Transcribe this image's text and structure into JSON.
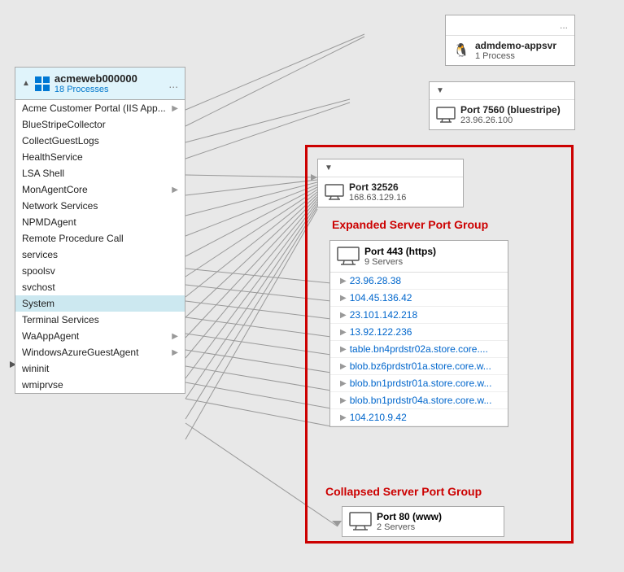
{
  "leftPanel": {
    "title": "acmeweb000000",
    "subtitle": "18 Processes",
    "menuLabel": "...",
    "processes": [
      {
        "name": "Acme Customer Portal (IIS App...",
        "hasArrow": true
      },
      {
        "name": "BlueStripeCollector",
        "hasArrow": false
      },
      {
        "name": "CollectGuestLogs",
        "hasArrow": false
      },
      {
        "name": "HealthService",
        "hasArrow": false
      },
      {
        "name": "LSA Shell",
        "hasArrow": false
      },
      {
        "name": "MonAgentCore",
        "hasArrow": true
      },
      {
        "name": "Network Services",
        "hasArrow": false
      },
      {
        "name": "NPMDAgent",
        "hasArrow": false
      },
      {
        "name": "Remote Procedure Call",
        "hasArrow": false
      },
      {
        "name": "services",
        "hasArrow": false
      },
      {
        "name": "spoolsv",
        "hasArrow": false
      },
      {
        "name": "svchost",
        "hasArrow": false
      },
      {
        "name": "System",
        "hasArrow": false,
        "active": true
      },
      {
        "name": "Terminal Services",
        "hasArrow": false
      },
      {
        "name": "WaAppAgent",
        "hasArrow": true
      },
      {
        "name": "WindowsAzureGuestAgent",
        "hasArrow": true
      },
      {
        "name": "wininit",
        "hasArrow": false
      },
      {
        "name": "wmiprvse",
        "hasArrow": false
      }
    ]
  },
  "topRightNode": {
    "title": "admdemo-appsvr",
    "subtitle": "1 Process",
    "menuLabel": "..."
  },
  "port7560Node": {
    "title": "Port 7560 (bluestripe)",
    "subtitle": "23.96.26.100"
  },
  "port32526Node": {
    "title": "Port 32526",
    "subtitle": "168.63.129.16"
  },
  "expandedGroup": {
    "label": "Expanded Server Port Group",
    "port443": {
      "title": "Port 443 (https)",
      "count": "9 Servers",
      "servers": [
        "23.96.28.38",
        "104.45.136.42",
        "23.101.142.218",
        "13.92.122.236",
        "table.bn4prdstr02a.store.core....",
        "blob.bz6prdstr01a.store.core.w...",
        "blob.bn1prdstr01a.store.core.w...",
        "blob.bn1prdstr04a.store.core.w...",
        "104.210.9.42"
      ]
    }
  },
  "collapsedGroup": {
    "label": "Collapsed Server Port Group",
    "port80": {
      "title": "Port 80 (www)",
      "count": "2 Servers"
    }
  }
}
